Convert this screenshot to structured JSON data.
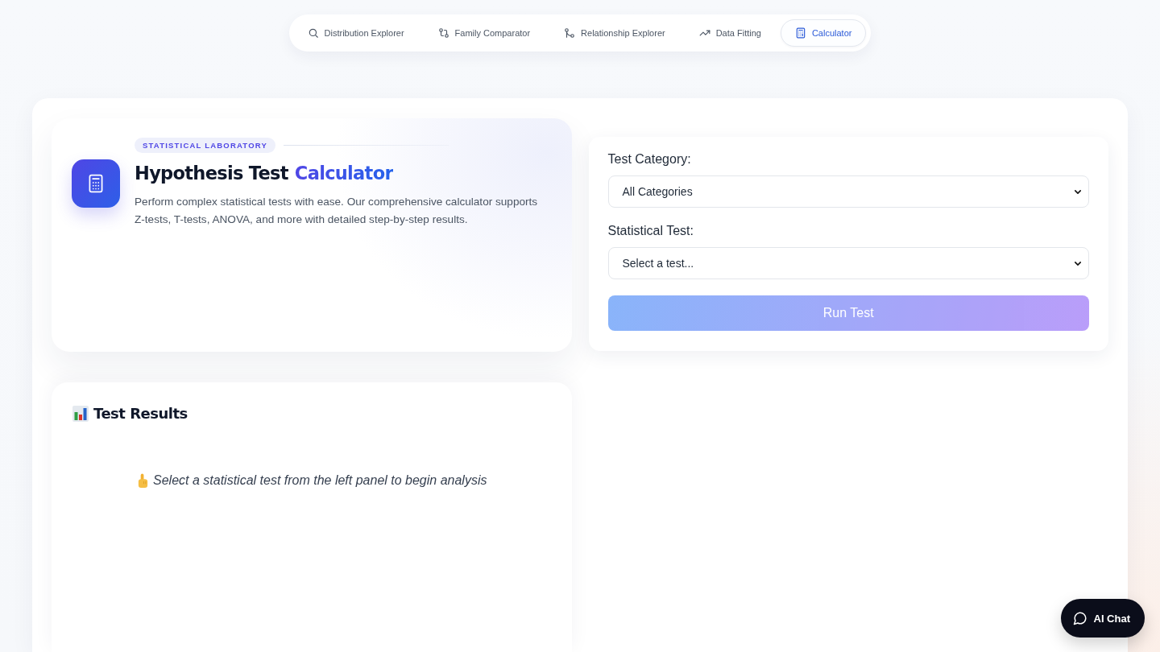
{
  "nav": {
    "tabs": [
      {
        "label": "Distribution Explorer",
        "selected": false
      },
      {
        "label": "Family Comparator",
        "selected": false
      },
      {
        "label": "Relationship Explorer",
        "selected": false
      },
      {
        "label": "Data Fitting",
        "selected": false
      },
      {
        "label": "Calculator",
        "selected": true
      }
    ]
  },
  "hero": {
    "badge": "STATISTICAL LABORATORY",
    "title": "Hypothesis Test",
    "title_highlight": "Calculator",
    "description": "Perform complex statistical tests with ease. Our comprehensive calculator supports Z-tests, T-tests, ANOVA, and more with detailed step-by-step results."
  },
  "form": {
    "fields": [
      {
        "label": "Test Category:",
        "value": "All Categories"
      },
      {
        "label": "Statistical Test:",
        "value": "Select a test..."
      }
    ],
    "run_button": {
      "label": "Run Test",
      "disabled": true
    }
  },
  "results": {
    "title": "Test Results",
    "message": "Select a statistical test from the left panel to begin analysis"
  },
  "chat_button": {
    "label": "AI Chat"
  }
}
